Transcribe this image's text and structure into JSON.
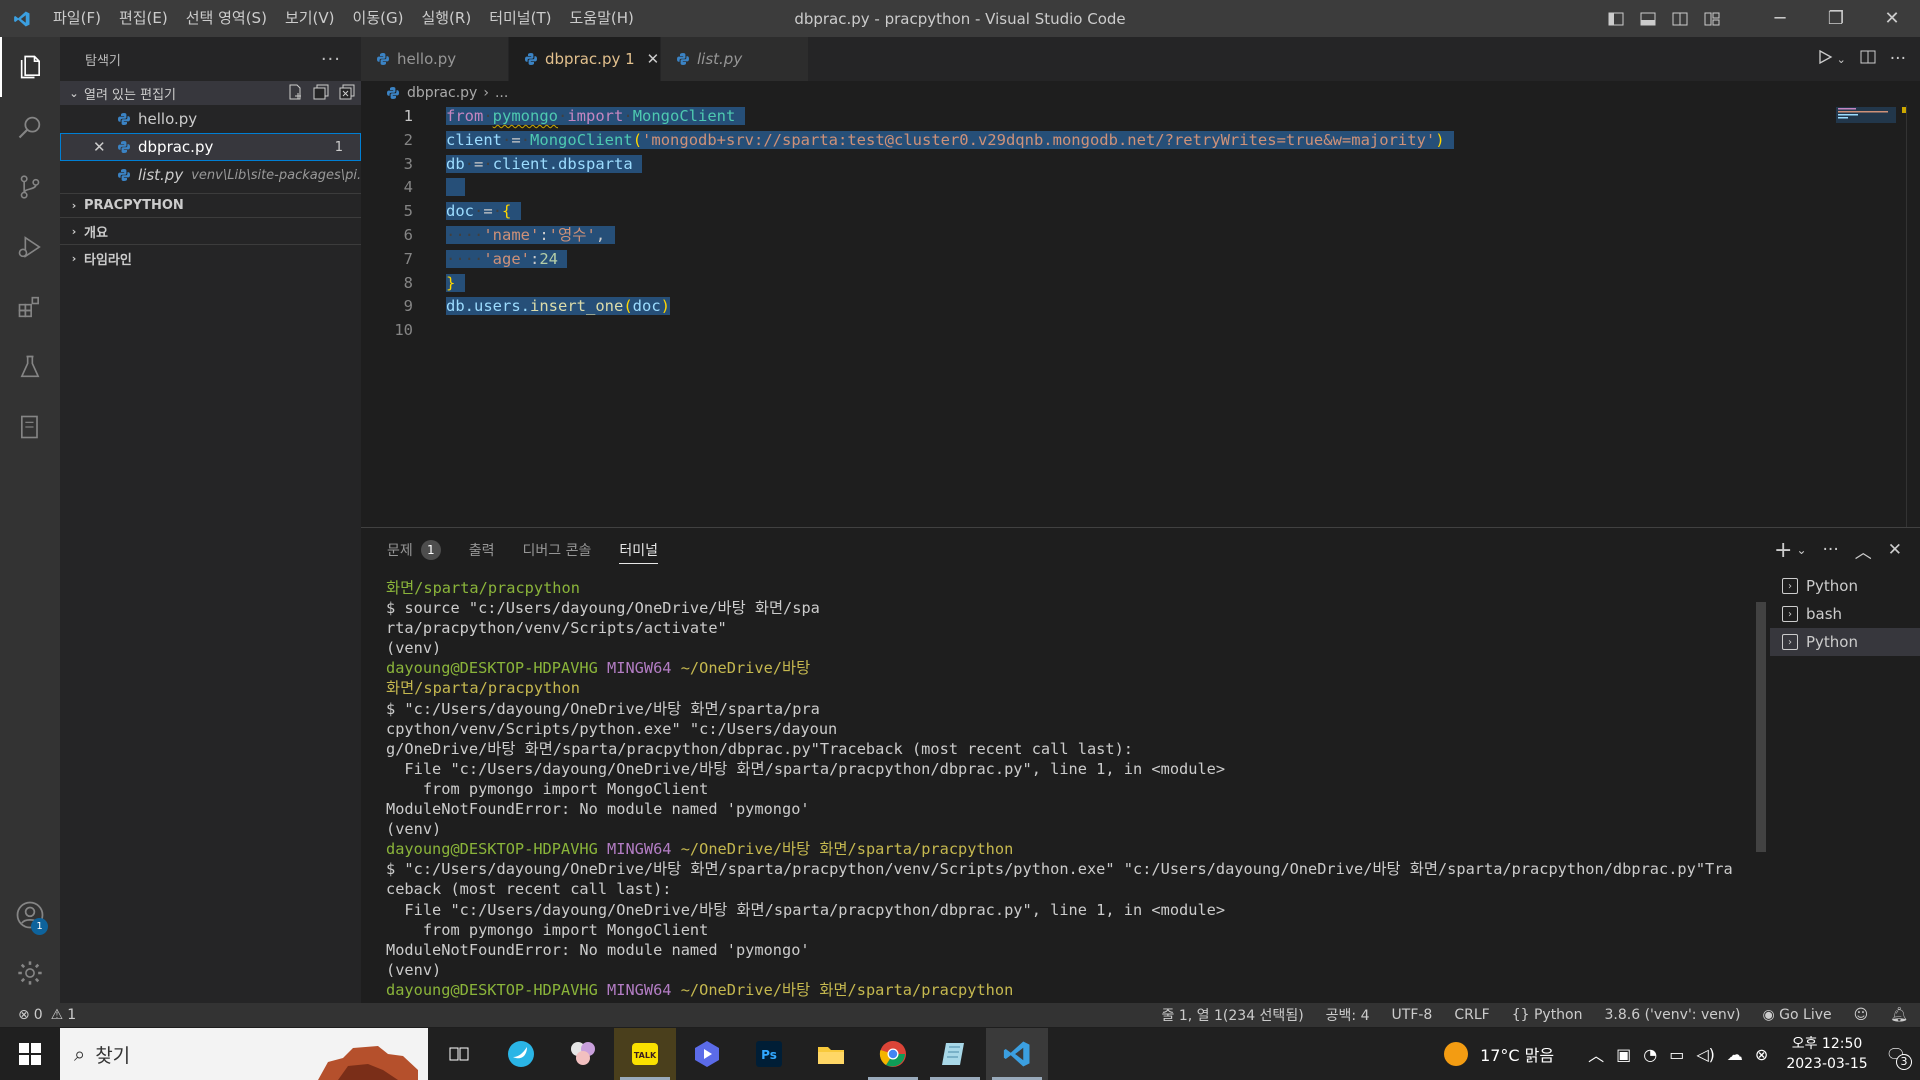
{
  "titlebar": {
    "title": "dbprac.py - pracpython - Visual Studio Code",
    "menu": [
      "파일(F)",
      "편집(E)",
      "선택 영역(S)",
      "보기(V)",
      "이동(G)",
      "실행(R)",
      "터미널(T)",
      "도움말(H)"
    ]
  },
  "sidebar": {
    "title": "탐색기",
    "open_editors": "열려 있는 편집기",
    "files": [
      {
        "name": "hello.py"
      },
      {
        "name": "dbprac.py",
        "badge": "1"
      },
      {
        "name": "list.py",
        "hint": "venv\\Lib\\site-packages\\pi..."
      }
    ],
    "sections": [
      "PRACPYTHON",
      "개요",
      "타임라인"
    ]
  },
  "tabs": [
    {
      "label": "hello.py"
    },
    {
      "label": "dbprac.py 1"
    },
    {
      "label": "list.py"
    }
  ],
  "breadcrumb": {
    "file": "dbprac.py",
    "rest": "..."
  },
  "code": {
    "line_numbers": [
      "1",
      "2",
      "3",
      "4",
      "5",
      "6",
      "7",
      "8",
      "9",
      "10"
    ],
    "l1": {
      "kw": "from",
      "mod": "pymongo",
      "kw2": "import",
      "cls": "MongoClient"
    },
    "l2": {
      "var": "client",
      "eq": "=",
      "fn": "MongoClient",
      "str": "'mongodb+srv://sparta:test@cluster0.v29dqnb.mongodb.net/?retryWrites=true&w=majority'"
    },
    "l3": {
      "var": "db",
      "eq": "=",
      "obj": "client",
      "attr": ".dbsparta"
    },
    "l5": {
      "var": "doc",
      "eq": "=",
      "brace": "{"
    },
    "l6": {
      "key": "'name'",
      "val": "'영수'"
    },
    "l7": {
      "key": "'age'",
      "val": "24"
    },
    "l8": {
      "brace": "}"
    },
    "l9": {
      "obj": "db",
      "attr": ".users.",
      "fn": "insert_one",
      "arg": "doc"
    }
  },
  "panel": {
    "tabs": [
      "문제",
      "출력",
      "디버그 콘솔",
      "터미널"
    ],
    "problem_count": "1",
    "terminals": [
      "Python",
      "bash",
      "Python"
    ]
  },
  "terminal": [
    {
      "g": "화면/sparta/pracpython"
    },
    {
      "t": "$ source \"c:/Users/dayoung/OneDrive/바탕 화면/spa"
    },
    {
      "t": "rta/pracpython/venv/Scripts/activate\""
    },
    {
      "t": "(venv)"
    },
    {
      "g": "dayoung@DESKTOP-HDPAVHG ",
      "m": "MINGW64 ",
      "y": "~/OneDrive/바탕"
    },
    {
      "y": "화면/sparta/pracpython"
    },
    {
      "t": "$ \"c:/Users/dayoung/OneDrive/바탕 화면/sparta/pra"
    },
    {
      "t": "cpython/venv/Scripts/python.exe\" \"c:/Users/dayoun"
    },
    {
      "t": "g/OneDrive/바탕 화면/sparta/pracpython/dbprac.py\"Traceback (most recent call last):"
    },
    {
      "t": "  File \"c:/Users/dayoung/OneDrive/바탕 화면/sparta/pracpython/dbprac.py\", line 1, in <module>"
    },
    {
      "t": "    from pymongo import MongoClient"
    },
    {
      "t": "ModuleNotFoundError: No module named 'pymongo'"
    },
    {
      "t": "(venv)"
    },
    {
      "g": "dayoung@DESKTOP-HDPAVHG ",
      "m": "MINGW64 ",
      "y": "~/OneDrive/바탕 화면/sparta/pracpython"
    },
    {
      "t": "$ \"c:/Users/dayoung/OneDrive/바탕 화면/sparta/pracpython/venv/Scripts/python.exe\" \"c:/Users/dayoung/OneDrive/바탕 화면/sparta/pracpython/dbprac.py\"Tra"
    },
    {
      "t": "ceback (most recent call last):"
    },
    {
      "t": "  File \"c:/Users/dayoung/OneDrive/바탕 화면/sparta/pracpython/dbprac.py\", line 1, in <module>"
    },
    {
      "t": "    from pymongo import MongoClient"
    },
    {
      "t": "ModuleNotFoundError: No module named 'pymongo'"
    },
    {
      "t": "(venv)"
    },
    {
      "g": "dayoung@DESKTOP-HDPAVHG ",
      "m": "MINGW64 ",
      "y": "~/OneDrive/바탕 화면/sparta/pracpython"
    }
  ],
  "status": {
    "errors": "0",
    "warnings": "1",
    "position": "줄 1, 열 1(234 선택됨)",
    "spaces": "공백: 4",
    "encoding": "UTF-8",
    "eol": "CRLF",
    "language": "Python",
    "interpreter": "3.8.6 ('venv': venv)",
    "golive": "Go Live"
  },
  "taskbar": {
    "search": "찾기",
    "weather": "17°C 맑음",
    "time": "오후 12:50",
    "date": "2023-03-15",
    "notif": "3"
  },
  "account_badge": "1"
}
